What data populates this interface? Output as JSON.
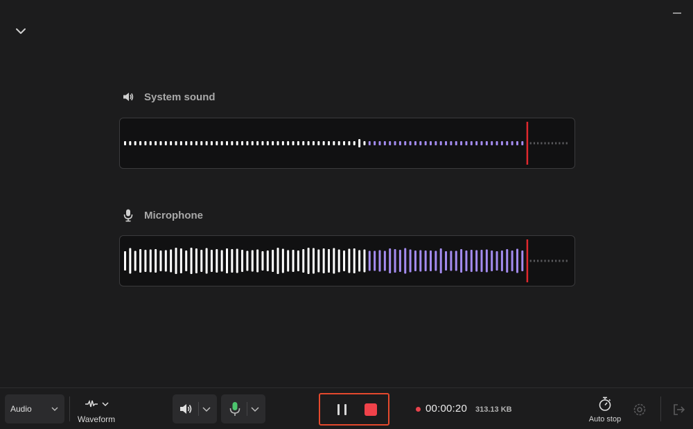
{
  "window": {
    "collapse_icon": "chevron-down-icon",
    "minimize_icon": "minimize-icon"
  },
  "tracks": [
    {
      "label": "System sound",
      "icon": "speaker-icon",
      "played_color": "#ffffff",
      "recorded_color": "#a48cf0",
      "bars_white": 48,
      "bars_purple": 31,
      "bars_pending": 11,
      "level": "low"
    },
    {
      "label": "Microphone",
      "icon": "microphone-icon",
      "played_color": "#ffffff",
      "recorded_color": "#a48cf0",
      "bars_white": 48,
      "bars_purple": 31,
      "bars_pending": 11,
      "level": "high"
    }
  ],
  "playhead_color": "#e0282e",
  "toolbar": {
    "mode_select": {
      "value": "Audio"
    },
    "waveform": {
      "label": "Waveform",
      "icon": "waveform-icon"
    },
    "system_sound_icon": "speaker-icon",
    "microphone_icon": "microphone-icon",
    "microphone_color": "#4cc46d",
    "pause_icon": "pause-icon",
    "stop_icon": "stop-icon",
    "timer": "00:00:20",
    "file_size": "313.13 KB",
    "auto_stop": {
      "label": "Auto stop",
      "icon": "stopwatch-icon"
    },
    "settings_icon": "gear-icon",
    "exit_icon": "exit-icon",
    "accent_color": "#e5492d"
  }
}
